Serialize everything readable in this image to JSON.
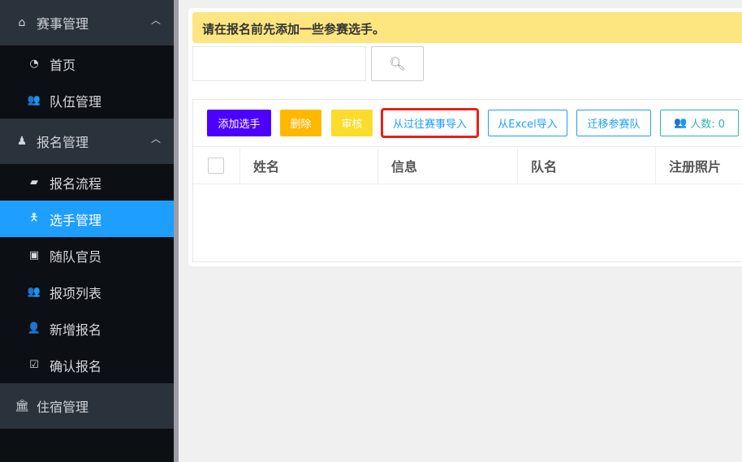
{
  "sidebar": {
    "sections": [
      {
        "label": "赛事管理",
        "icon": "home-icon",
        "items": [
          {
            "label": "首页",
            "icon": "dashboard-icon"
          },
          {
            "label": "队伍管理",
            "icon": "users-icon"
          }
        ]
      },
      {
        "label": "报名管理",
        "icon": "person-icon",
        "items": [
          {
            "label": "报名流程",
            "icon": "book-icon"
          },
          {
            "label": "选手管理",
            "icon": "child-icon",
            "active": true
          },
          {
            "label": "随队官员",
            "icon": "contact-card-icon"
          },
          {
            "label": "报项列表",
            "icon": "users-icon"
          },
          {
            "label": "新增报名",
            "icon": "user-plus-icon"
          },
          {
            "label": "确认报名",
            "icon": "check-square-icon"
          }
        ]
      },
      {
        "label": "住宿管理",
        "icon": "bank-icon"
      }
    ]
  },
  "main": {
    "alert": "请在报名前先添加一些参赛选手。",
    "search": {
      "value": "",
      "placeholder": ""
    },
    "toolbar": {
      "add": "添加选手",
      "delete": "删除",
      "review": "审核",
      "import_past": "从过往赛事导入",
      "import_excel": "从Excel导入",
      "migrate": "迁移参赛队",
      "count": "人数: 0"
    },
    "table": {
      "columns": [
        "姓名",
        "信息",
        "队名",
        "注册照片"
      ],
      "rows": []
    }
  },
  "colors": {
    "accent": "#1e9fff",
    "add": "#4c00ff",
    "delete": "#ffb800",
    "review": "#fbdc2b",
    "highlight": "#e8201a",
    "teal": "#2cb7a4"
  }
}
